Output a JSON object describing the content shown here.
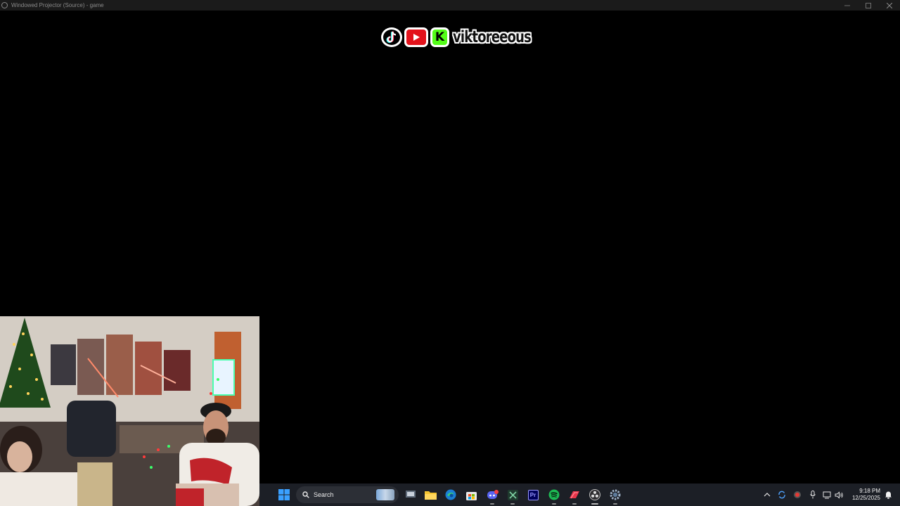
{
  "window": {
    "title": "Windowed Projector (Source) - game",
    "controls": [
      "minimize-icon",
      "maximize-icon",
      "close-icon"
    ]
  },
  "banner": {
    "platform_icons": [
      "tiktok-icon",
      "youtube-icon",
      "kick-icon"
    ],
    "kick_letter": "K",
    "handle": "viktoreeous"
  },
  "webcam": {
    "description_icon": "webcam-feed"
  },
  "taskbar": {
    "search_placeholder": "Search",
    "pinned_apps": [
      "start-icon",
      "task-view-icon",
      "file-explorer-icon",
      "edge-icon",
      "store-icon",
      "discord-icon",
      "excel-icon",
      "premiere-pro-icon",
      "spotify-icon",
      "app-red-icon",
      "obs-icon",
      "settings-icon"
    ],
    "premiere_label": "Pr",
    "tray_icons": [
      "show-hidden-icon",
      "sync-icon",
      "record-icon",
      "microphone-icon",
      "network-icon",
      "volume-icon",
      "notification-icon"
    ],
    "time": "9:18 PM",
    "date": "12/25/2025"
  },
  "colors": {
    "taskbar_bg": "#1c1f26",
    "titlebar_bg": "#1b1b1b",
    "kick_green": "#53fc18",
    "youtube_red": "#e3121b",
    "spotify_green": "#1db954"
  }
}
